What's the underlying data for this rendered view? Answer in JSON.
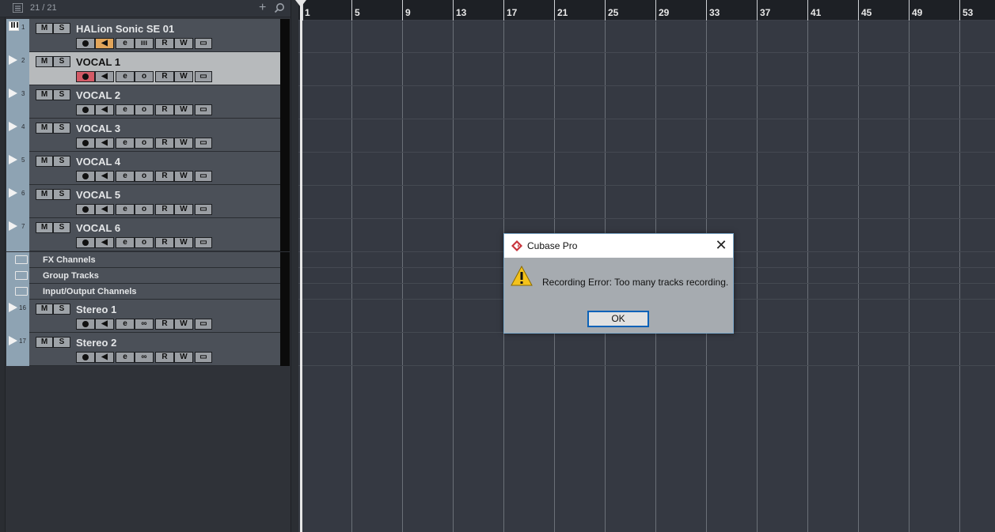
{
  "tracklist": {
    "count": "21 / 21"
  },
  "tracks": [
    {
      "number": "1",
      "name": "HALion Sonic SE 01",
      "type": "instrument"
    },
    {
      "number": "2",
      "name": "VOCAL 1",
      "type": "audio"
    },
    {
      "number": "3",
      "name": "VOCAL 2",
      "type": "audio"
    },
    {
      "number": "4",
      "name": "VOCAL 3",
      "type": "audio"
    },
    {
      "number": "5",
      "name": "VOCAL 4",
      "type": "audio"
    },
    {
      "number": "6",
      "name": "VOCAL 5",
      "type": "audio"
    },
    {
      "number": "7",
      "name": "VOCAL 6",
      "type": "audio"
    }
  ],
  "folders": [
    {
      "name": "FX Channels"
    },
    {
      "name": "Group Tracks"
    },
    {
      "name": "Input/Output Channels"
    }
  ],
  "output_tracks": [
    {
      "number": "16",
      "name": "Stereo 1"
    },
    {
      "number": "17",
      "name": "Stereo 2"
    }
  ],
  "buttons": {
    "mute": "M",
    "solo": "S",
    "read": "R",
    "write": "W",
    "edit": "e",
    "monitor_off": "o",
    "link": "∞"
  },
  "ruler": {
    "bars": [
      "1",
      "5",
      "9",
      "13",
      "17",
      "21",
      "25",
      "29",
      "33",
      "37",
      "41",
      "45",
      "49",
      "53"
    ]
  },
  "dialog": {
    "title": "Cubase Pro",
    "message": "Recording Error: Too many tracks recording.",
    "ok_label": "OK",
    "close_glyph": "✕"
  },
  "colors": {
    "record_armed": "#d35a66",
    "monitor_on": "#e2a55a",
    "track_color": "#8ea3b3",
    "selected_track": "#b7babc"
  }
}
